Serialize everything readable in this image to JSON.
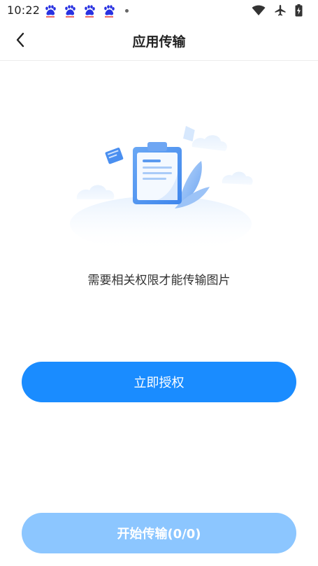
{
  "status_bar": {
    "time": "10:22"
  },
  "header": {
    "title": "应用传输"
  },
  "main": {
    "message": "需要相关权限才能传输图片"
  },
  "buttons": {
    "authorize_label": "立即授权",
    "start_transfer_label": "开始传输(0/0)"
  },
  "icons": {
    "notification": [
      "baidu-icon",
      "baidu-icon",
      "baidu-icon",
      "baidu-icon",
      "more-dot-icon"
    ],
    "status_right": [
      "wifi-icon",
      "airplane-icon",
      "battery-icon"
    ],
    "back": "back-arrow-icon",
    "illustration": "clipboard-document-icon"
  },
  "colors": {
    "primary": "#1a8cff",
    "primary_disabled": "#8cc6ff",
    "baidu_blue": "#2932e1",
    "baidu_red": "#e53935"
  }
}
